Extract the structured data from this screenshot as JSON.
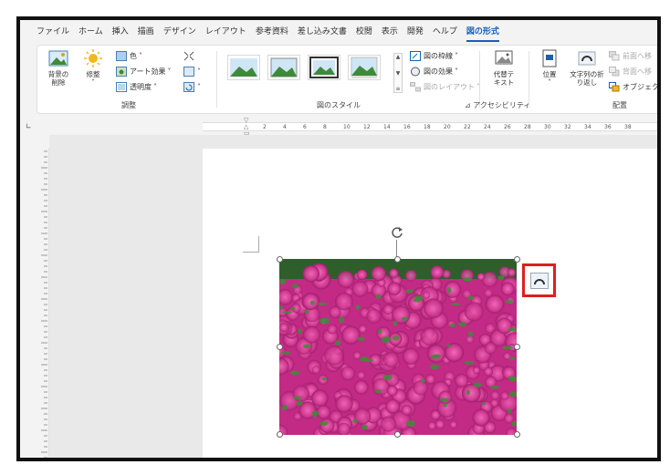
{
  "menu": {
    "tabs": [
      {
        "label": "ファイル"
      },
      {
        "label": "ホーム"
      },
      {
        "label": "挿入"
      },
      {
        "label": "描画"
      },
      {
        "label": "デザイン"
      },
      {
        "label": "レイアウト"
      },
      {
        "label": "参考資料"
      },
      {
        "label": "差し込み文書"
      },
      {
        "label": "校閲"
      },
      {
        "label": "表示"
      },
      {
        "label": "開発"
      },
      {
        "label": "ヘルプ"
      },
      {
        "label": "図の形式"
      }
    ],
    "active": "図の形式"
  },
  "ribbon": {
    "adjust": {
      "remove_bg": "背景の\n削除",
      "corrections": "修整",
      "color": "色",
      "art_effects": "アート効果",
      "transparency": "透明度",
      "group_label": "調整"
    },
    "picture_styles": {
      "border": "図の枠線",
      "effects": "図の効果",
      "layout": "図のレイアウト",
      "group_label": "図のスタイル"
    },
    "accessibility": {
      "alt_text": "代替テ\nキスト",
      "group_label": "アクセシビリティ"
    },
    "arrange": {
      "position": "位置",
      "wrap_text": "文字列の折\nり返し",
      "bring_forward": "前面へ移",
      "send_backward": "背面へ移",
      "object": "オブジェクト",
      "group_label": "配置"
    }
  },
  "ruler": {
    "numbers": [
      "2",
      "4",
      "6",
      "8",
      "10",
      "12",
      "14",
      "16",
      "18",
      "20",
      "22",
      "24",
      "26",
      "28",
      "30",
      "32",
      "34",
      "36",
      "38"
    ]
  },
  "icons": {
    "layout_options": "layout-options-icon",
    "rotate": "rotate-icon"
  },
  "colors": {
    "accent": "#1a5fb4",
    "highlight_box": "#e01e1e",
    "flower_pink": "#d23a93",
    "leaf_green": "#3f8a3a"
  }
}
